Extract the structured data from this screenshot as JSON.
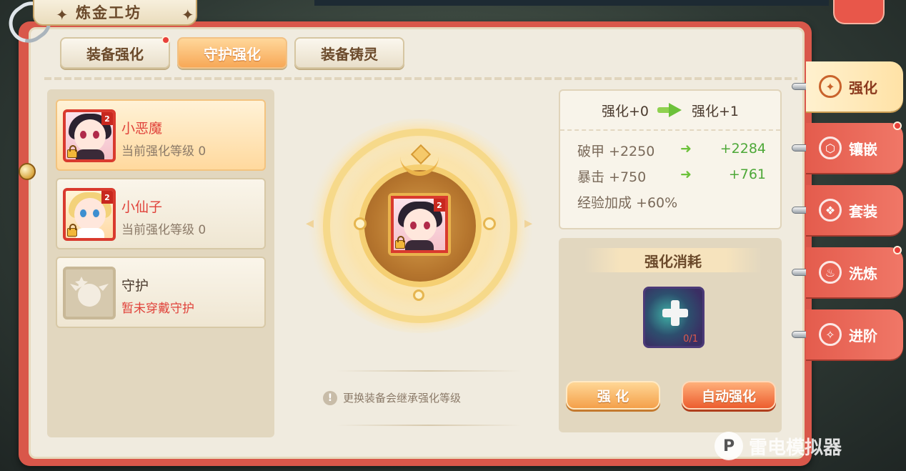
{
  "header": {
    "title": "炼金工坊"
  },
  "top_tabs": [
    {
      "label": "装备强化",
      "active": false,
      "badge": true
    },
    {
      "label": "守护强化",
      "active": true,
      "badge": false
    },
    {
      "label": "装备铸灵",
      "active": false,
      "badge": false
    }
  ],
  "guardians": [
    {
      "name": "小恶魔",
      "subtitle": "当前强化等级 0",
      "level_badge": "2",
      "selected": true
    },
    {
      "name": "小仙子",
      "subtitle": "当前强化等级 0",
      "level_badge": "2",
      "selected": false
    },
    {
      "name": "守护",
      "subtitle": "暂未穿戴守护",
      "selected": false
    }
  ],
  "center": {
    "level_badge": "2",
    "hint": "更换装备会继承强化等级"
  },
  "stats": {
    "from": "强化+0",
    "to": "强化+1",
    "rows": [
      {
        "label": "破甲 +2250",
        "new": "+2284"
      },
      {
        "label": "暴击 +750",
        "new": "+761"
      },
      {
        "label": "经验加成 +60%",
        "new": ""
      }
    ]
  },
  "cost": {
    "title": "强化消耗",
    "count": "0/1",
    "enhance_label": "强 化",
    "auto_label": "自动强化"
  },
  "side_tabs": [
    {
      "label": "强化",
      "icon": "enhance-icon",
      "active": true,
      "badge": false
    },
    {
      "label": "镶嵌",
      "icon": "inlay-icon",
      "active": false,
      "badge": true
    },
    {
      "label": "套装",
      "icon": "set-icon",
      "active": false,
      "badge": false
    },
    {
      "label": "洗炼",
      "icon": "refine-icon",
      "active": false,
      "badge": true
    },
    {
      "label": "进阶",
      "icon": "advance-icon",
      "active": false,
      "badge": false
    }
  ],
  "watermark": {
    "text": "雷电模拟器"
  },
  "colors": {
    "accent_orange": "#f7a857",
    "book_red": "#d9574a",
    "page_bg": "#f0ebdf",
    "green_value": "#4da838",
    "red_text": "#e0423a"
  }
}
